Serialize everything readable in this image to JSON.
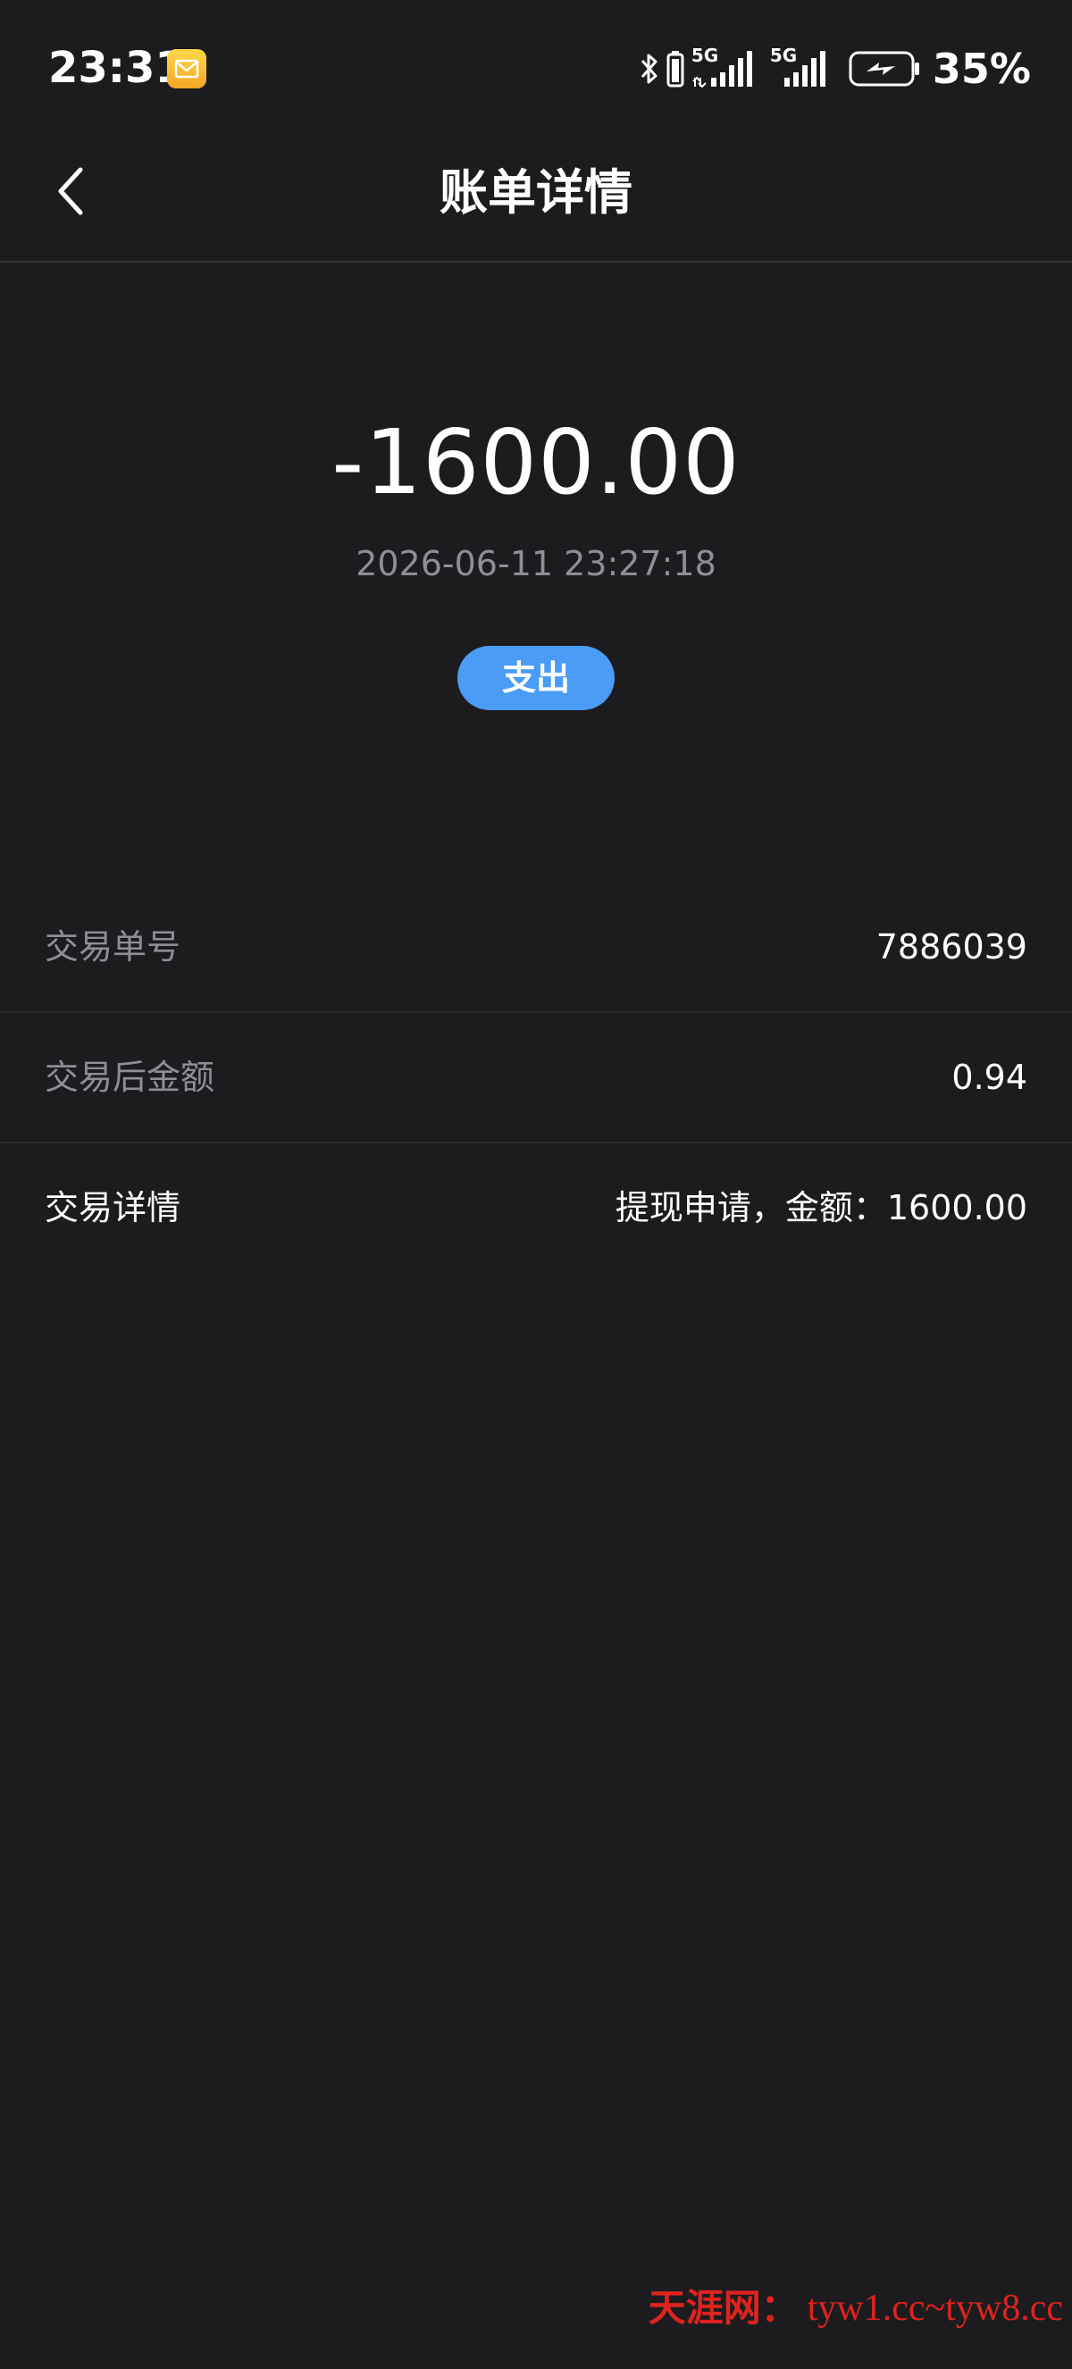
{
  "status_bar": {
    "time": "23:31",
    "app_icon": "mail-notification-icon",
    "icons": [
      "bluetooth-icon",
      "battery-small-icon",
      "signal-5g-icon",
      "signal-5g-icon",
      "charging-battery-icon"
    ],
    "network_label_1": "5G",
    "network_label_2": "5G",
    "battery_percent": "35%"
  },
  "nav": {
    "back_icon": "chevron-left-icon",
    "title": "账单详情"
  },
  "summary": {
    "amount": "-1600.00",
    "datetime": "2026-06-11 23:27:18",
    "type_badge": "支出",
    "badge_color": "#4a9cf7"
  },
  "details": [
    {
      "label": "交易单号",
      "value": "7886039"
    },
    {
      "label": "交易后金额",
      "value": "0.94"
    },
    {
      "label": "交易详情",
      "value": "提现申请，金额：1600.00"
    }
  ],
  "watermark": {
    "site_name": "天涯网：",
    "urls": "tyw1.cc~tyw8.cc"
  },
  "colors": {
    "background": "#1c1c1e",
    "muted_text": "#8e8e99",
    "watermark": "#e0221e"
  }
}
